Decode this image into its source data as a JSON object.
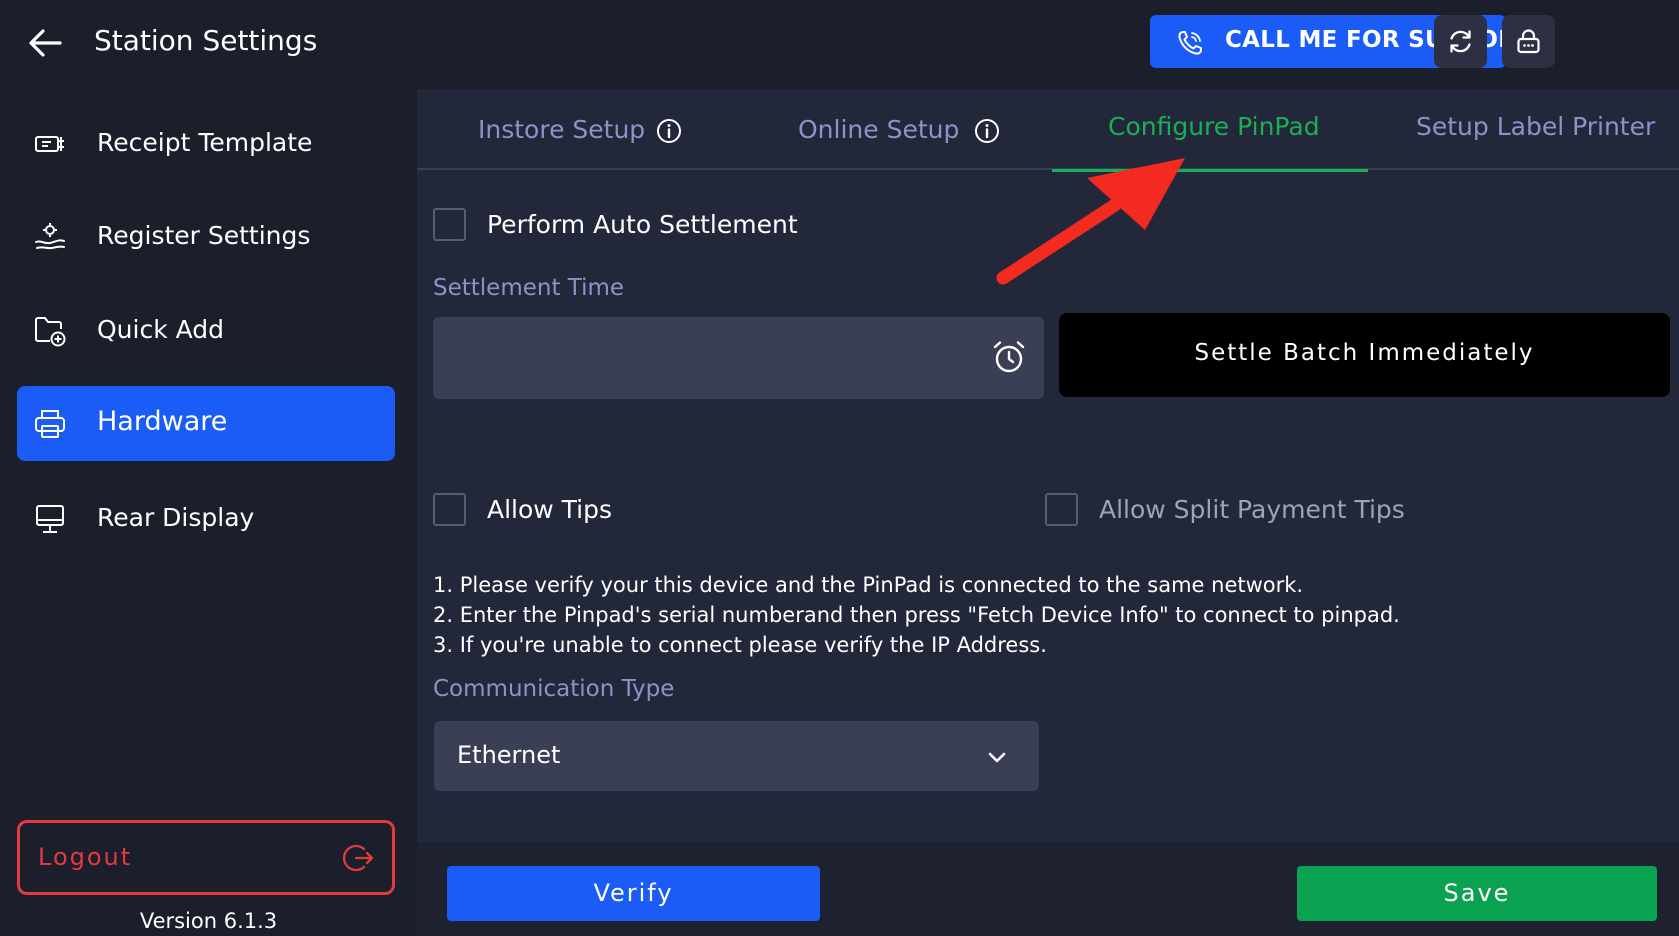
{
  "header": {
    "title": "Station Settings",
    "support_label": "CALL ME FOR SUPPORT",
    "icons": {
      "back": "arrow-left-icon",
      "phone": "phone-icon",
      "refresh": "refresh-icon",
      "lock": "lock-icon"
    }
  },
  "sidebar": {
    "items": [
      {
        "label": "Receipt Template",
        "icon": "receipt-icon",
        "active": false
      },
      {
        "label": "Register Settings",
        "icon": "register-icon",
        "active": false
      },
      {
        "label": "Quick Add",
        "icon": "folder-add-icon",
        "active": false
      },
      {
        "label": "Hardware",
        "icon": "printer-icon",
        "active": true
      },
      {
        "label": "Rear Display",
        "icon": "monitor-icon",
        "active": false
      }
    ],
    "logout_label": "Logout",
    "version": "Version 6.1.3"
  },
  "tabs": [
    {
      "label": "Instore Setup",
      "info_icon": true,
      "active": false
    },
    {
      "label": "Online Setup",
      "info_icon": true,
      "active": false
    },
    {
      "label": "Configure PinPad",
      "info_icon": false,
      "active": true
    },
    {
      "label": "Setup Label Printer",
      "info_icon": false,
      "active": false
    }
  ],
  "pinpad": {
    "auto_settlement_label": "Perform Auto Settlement",
    "auto_settlement_checked": false,
    "settlement_time_label": "Settlement Time",
    "settlement_time_value": "",
    "settle_button_label": "Settle Batch Immediately",
    "allow_tips_label": "Allow Tips",
    "allow_tips_checked": false,
    "allow_split_tips_label": "Allow Split Payment Tips",
    "allow_split_tips_checked": false,
    "instructions": [
      "1. Please verify your this device and the PinPad is connected to the same network.",
      "2. Enter the Pinpad's serial numberand then press \"Fetch Device Info\" to connect to pinpad.",
      "3. If you're unable to connect please verify the IP Address."
    ],
    "communication_type_label": "Communication Type",
    "communication_type_value": "Ethernet"
  },
  "footer": {
    "verify_label": "Verify",
    "save_label": "Save"
  },
  "colors": {
    "accent_blue": "#1a5cf5",
    "accent_green": "#1cae56",
    "save_green": "#0aa150",
    "danger_red": "#e5393f",
    "annotation_red": "#f22a1f"
  }
}
